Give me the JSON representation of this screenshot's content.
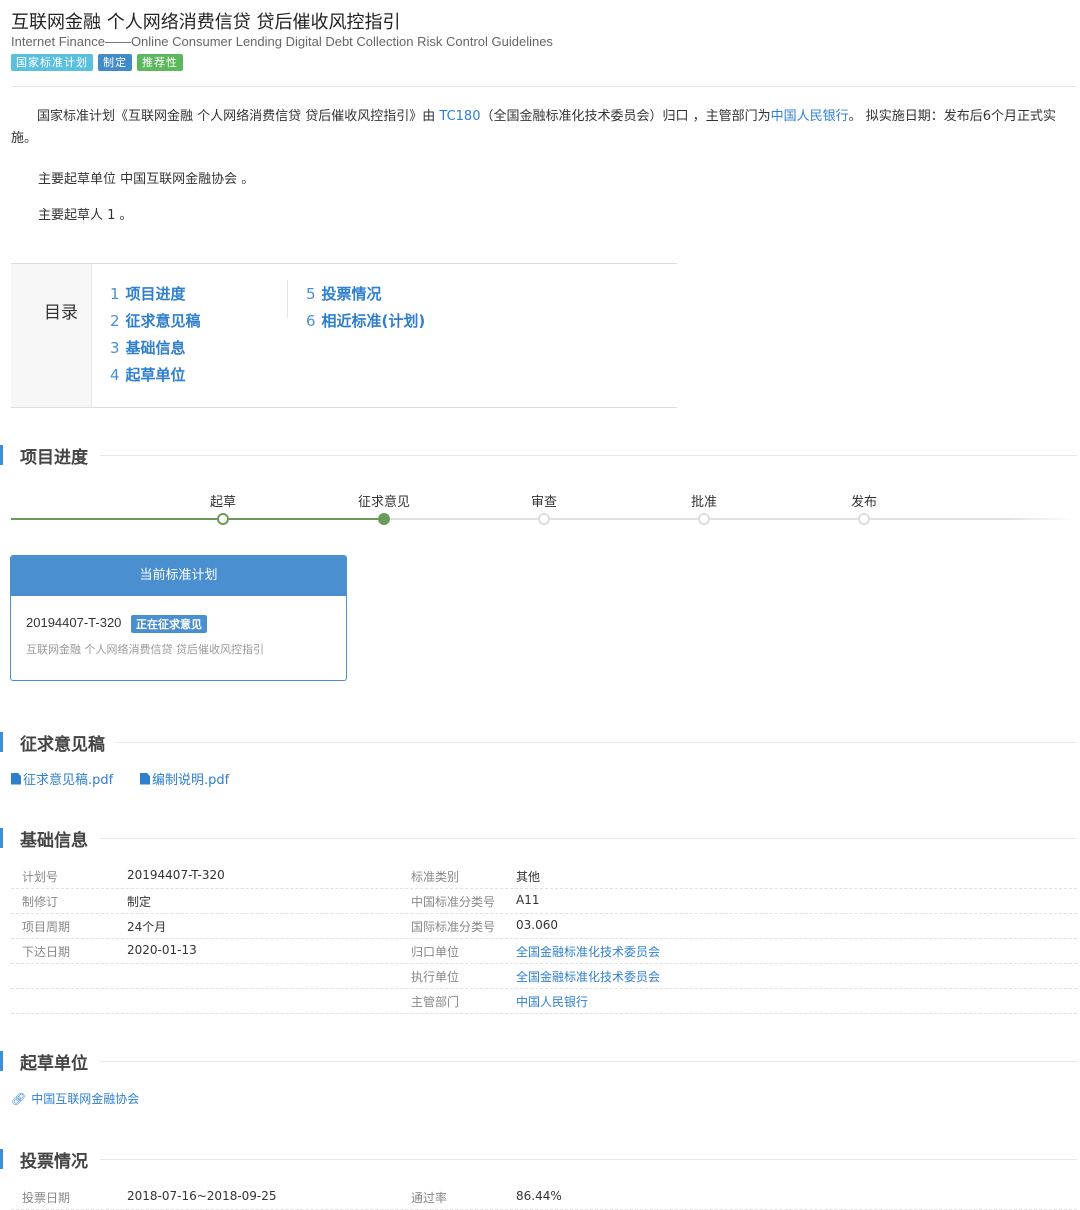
{
  "header": {
    "title": "互联网金融 个人网络消费信贷 贷后催收风控指引",
    "subtitle": "Internet Finance——Online Consumer Lending Digital Debt Collection Risk Control Guidelines",
    "tags": [
      "国家标准计划",
      "制定",
      "推荐性"
    ],
    "tag_colors": [
      "#5bc0de",
      "#428bca",
      "#5cb85c"
    ]
  },
  "intro": {
    "p1_a": "国家标准计划《互联网金融 个人网络消费信贷 贷后催收风控指引》由 ",
    "p1_tc": "TC180",
    "p1_b": "（全国金融标准化技术委员会）归口 ，主管部门为",
    "p1_dept": "中国人民银行",
    "p1_c": "。 拟实施日期：发布后6个月正式实施。",
    "p2": "主要起草单位 中国互联网金融协会 。",
    "p3": "主要起草人 1 。"
  },
  "toc": {
    "title": "目录",
    "items": [
      {
        "num": "1",
        "label": "项目进度"
      },
      {
        "num": "2",
        "label": "征求意见稿"
      },
      {
        "num": "3",
        "label": "基础信息"
      },
      {
        "num": "4",
        "label": "起草单位"
      },
      {
        "num": "5",
        "label": "投票情况"
      },
      {
        "num": "6",
        "label": "相近标准(计划)"
      }
    ]
  },
  "progress": {
    "title": "项目进度",
    "steps": [
      "起草",
      "征求意见",
      "审查",
      "批准",
      "发布"
    ],
    "current_step_index": 1,
    "accent_color": "#6b9a5b"
  },
  "plan_card": {
    "heading": "当前标准计划",
    "plan_no": "20194407-T-320",
    "status_badge": "正在征求意见",
    "name": "互联网金融 个人网络消费信贷 贷后催收风控指引"
  },
  "drafts": {
    "title": "征求意见稿",
    "files": [
      "征求意见稿.pdf",
      "编制说明.pdf"
    ]
  },
  "basic_info": {
    "title": "基础信息",
    "rows": [
      {
        "l1": "计划号",
        "v1": "20194407-T-320",
        "l2": "标准类别",
        "v2": "其他",
        "v2_link": false
      },
      {
        "l1": "制修订",
        "v1": "制定",
        "l2": "中国标准分类号",
        "v2": "A11",
        "v2_link": false
      },
      {
        "l1": "项目周期",
        "v1": "24个月",
        "l2": "国际标准分类号",
        "v2": "03.060",
        "v2_link": false
      },
      {
        "l1": "下达日期",
        "v1": "2020-01-13",
        "l2": "归口单位",
        "v2": "全国金融标准化技术委员会",
        "v2_link": true
      },
      {
        "l1": "",
        "v1": "",
        "l2": "执行单位",
        "v2": "全国金融标准化技术委员会",
        "v2_link": true
      },
      {
        "l1": "",
        "v1": "",
        "l2": "主管部门",
        "v2": "中国人民银行",
        "v2_link": true
      }
    ]
  },
  "drafting_units": {
    "title": "起草单位",
    "units": [
      "中国互联网金融协会"
    ]
  },
  "voting": {
    "title": "投票情况",
    "date_label": "投票日期",
    "date_value": "2018-07-16~2018-09-25",
    "rate_label": "通过率",
    "rate_value": "86.44%"
  }
}
